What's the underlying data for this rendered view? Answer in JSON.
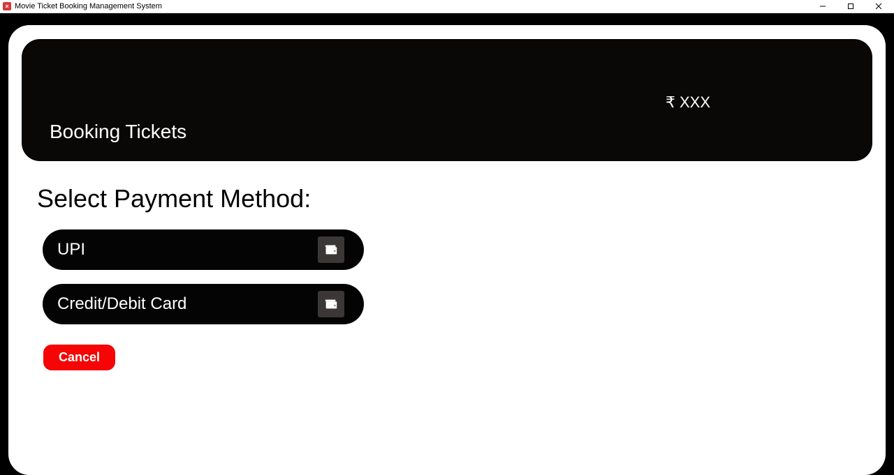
{
  "window": {
    "title": "Movie Ticket Booking Management System"
  },
  "header": {
    "price": "₹ XXX",
    "title": "Booking Tickets"
  },
  "payment": {
    "heading": "Select Payment Method:",
    "options": {
      "upi": {
        "label": "UPI"
      },
      "card": {
        "label": "Credit/Debit Card"
      }
    },
    "cancel_label": "Cancel"
  }
}
